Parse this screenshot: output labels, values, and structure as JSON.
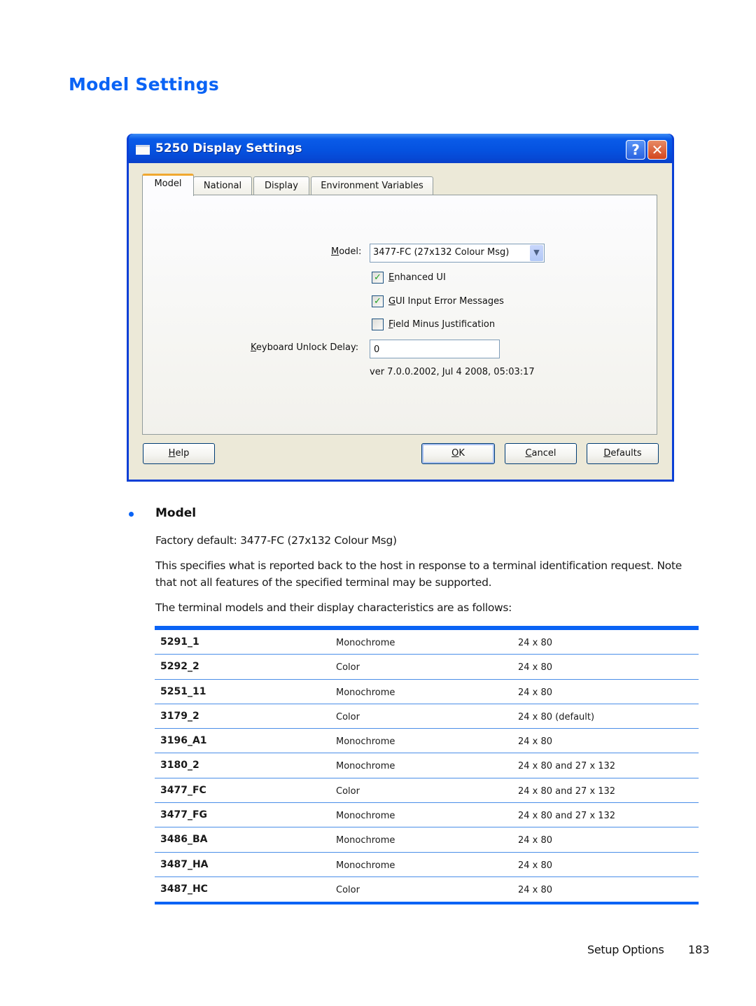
{
  "page": {
    "title": "Model Settings",
    "footer": {
      "section": "Setup Options",
      "page_number": "183"
    }
  },
  "dialog": {
    "title": "5250 Display Settings",
    "titlebar_buttons": {
      "help": "?",
      "close": "✕"
    },
    "tabs": [
      {
        "label": "Model",
        "active": true
      },
      {
        "label": "National",
        "active": false
      },
      {
        "label": "Display",
        "active": false
      },
      {
        "label": "Environment Variables",
        "active": false
      }
    ],
    "model": {
      "label": "Model:",
      "label_mnemonic": "M",
      "selected": "3477-FC (27x132 Colour Msg)"
    },
    "checkboxes": [
      {
        "label": "Enhanced UI",
        "mnemonic": "E",
        "checked": true
      },
      {
        "label": "GUI Input Error Messages",
        "mnemonic": "G",
        "checked": true
      },
      {
        "label": "Field Minus Justification",
        "mnemonic": "F",
        "checked": false
      }
    ],
    "keyboard_unlock_delay": {
      "label": "Keyboard Unlock Delay:",
      "mnemonic": "K",
      "value": "0"
    },
    "version": "ver 7.0.0.2002, Jul  4 2008, 05:03:17",
    "buttons": {
      "help": "Help",
      "ok": "OK",
      "cancel": "Cancel",
      "defaults": "Defaults"
    }
  },
  "section": {
    "heading": "Model",
    "factory_default": "Factory default: 3477-FC (27x132 Colour Msg)",
    "description": "This specifies what is reported back to the host in response to a terminal identification request. Note that not all features of the specified terminal may be supported.",
    "intro": "The terminal models and their display characteristics are as follows:"
  },
  "table": {
    "rows": [
      [
        "5291_1",
        "Monochrome",
        "24 x 80"
      ],
      [
        "5292_2",
        "Color",
        "24 x 80"
      ],
      [
        "5251_11",
        "Monochrome",
        "24 x 80"
      ],
      [
        "3179_2",
        "Color",
        "24 x 80 (default)"
      ],
      [
        "3196_A1",
        "Monochrome",
        "24 x 80"
      ],
      [
        "3180_2",
        "Monochrome",
        "24 x 80 and 27 x 132"
      ],
      [
        "3477_FC",
        "Color",
        "24 x 80 and 27 x 132"
      ],
      [
        "3477_FG",
        "Monochrome",
        "24 x 80 and 27 x 132"
      ],
      [
        "3486_BA",
        "Monochrome",
        "24 x 80"
      ],
      [
        "3487_HA",
        "Monochrome",
        "24 x 80"
      ],
      [
        "3487_HC",
        "Color",
        "24 x 80"
      ]
    ]
  }
}
